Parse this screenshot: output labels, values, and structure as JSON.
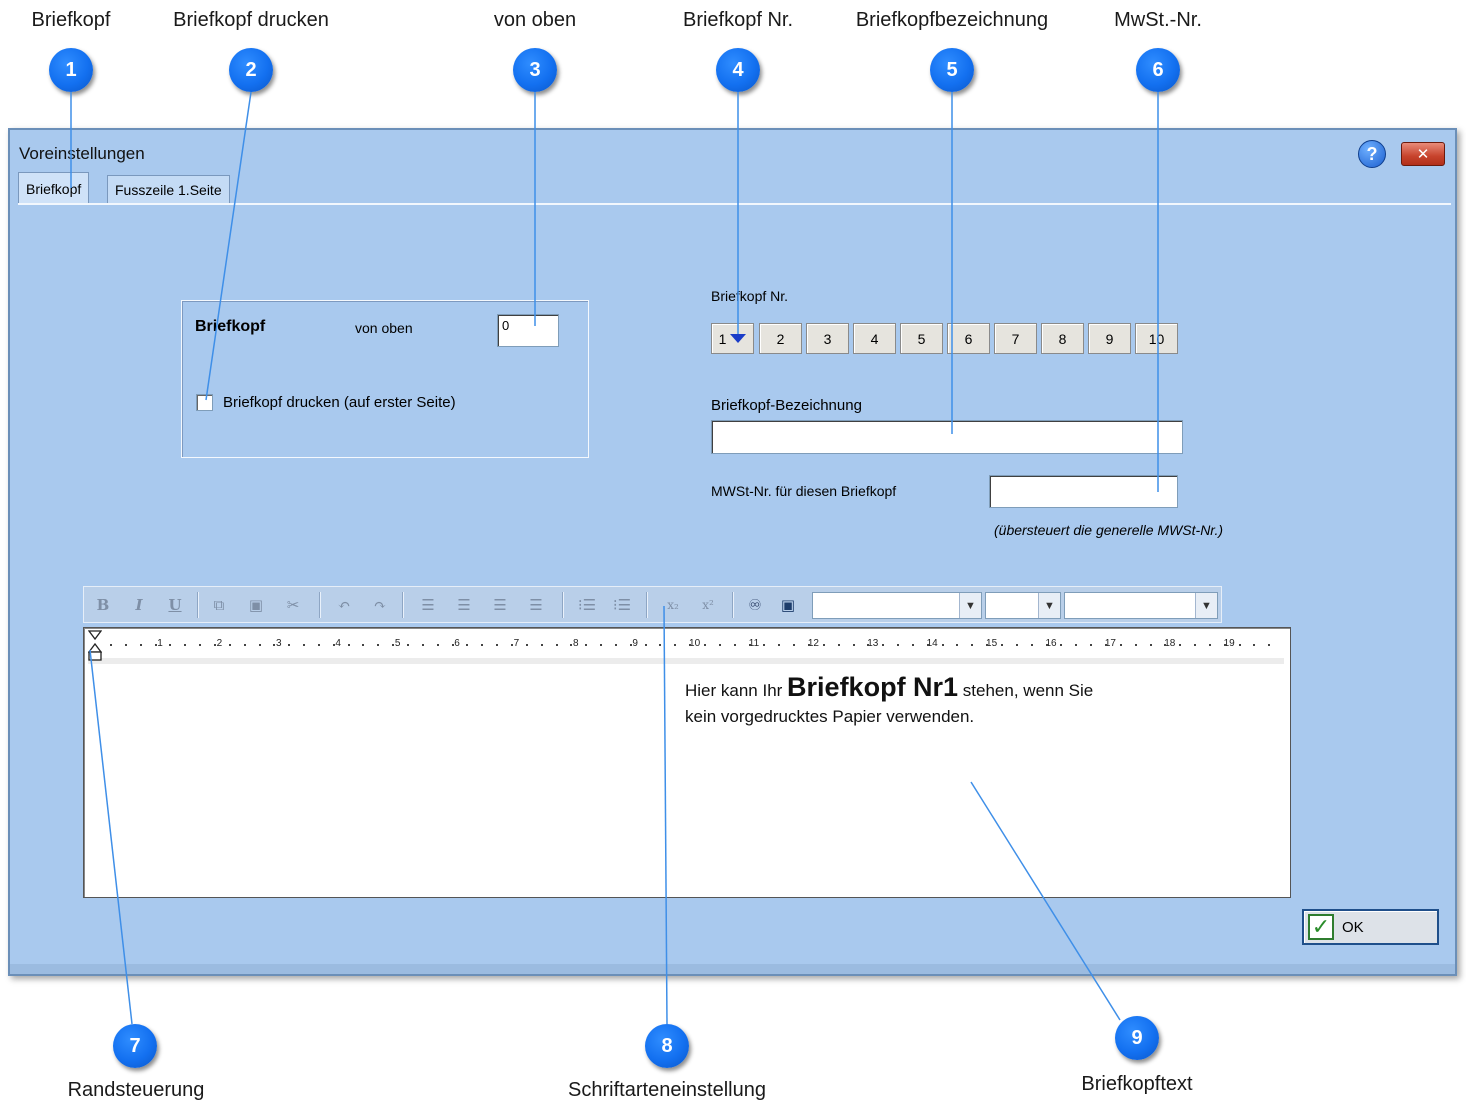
{
  "callouts": [
    {
      "n": "1",
      "label": "Briefkopf"
    },
    {
      "n": "2",
      "label": "Briefkopf drucken"
    },
    {
      "n": "3",
      "label": "von oben"
    },
    {
      "n": "4",
      "label": "Briefkopf Nr."
    },
    {
      "n": "5",
      "label": "Briefkopfbezeichnung"
    },
    {
      "n": "6",
      "label": "MwSt.-Nr."
    },
    {
      "n": "7",
      "label": "Randsteuerung"
    },
    {
      "n": "8",
      "label": "Schriftarteneinstellung"
    },
    {
      "n": "9",
      "label": "Briefkopftext"
    }
  ],
  "dialog": {
    "title": "Voreinstellungen",
    "help_symbol": "?",
    "close_symbol": "✕",
    "tabs": [
      "Briefkopf",
      "Fusszeile 1.Seite"
    ]
  },
  "briefkopf_group": {
    "heading": "Briefkopf",
    "von_oben_label": "von oben",
    "von_oben_value": "0",
    "print_checkbox_label": "Briefkopf drucken (auf erster Seite)",
    "print_checked": false
  },
  "briefkopf_nr": {
    "label": "Briefkopf Nr.",
    "buttons": [
      "1",
      "2",
      "3",
      "4",
      "5",
      "6",
      "7",
      "8",
      "9",
      "10"
    ],
    "selected": "1"
  },
  "bezeichnung": {
    "label": "Briefkopf-Bezeichnung",
    "value": ""
  },
  "mwst": {
    "label": "MWSt-Nr. für diesen Briefkopf",
    "value": "",
    "note": "(übersteuert die generelle MWSt-Nr.)"
  },
  "toolbar": {
    "icons": [
      "bold-icon",
      "italic-icon",
      "underline-icon",
      "copy-icon",
      "paste-icon",
      "cut-icon",
      "undo-icon",
      "redo-icon",
      "align-left-icon",
      "align-center-icon",
      "align-right-icon",
      "justify-icon",
      "bullet-list-icon",
      "numbered-list-icon",
      "subscript-icon",
      "superscript-icon",
      "find-icon",
      "insert-field-icon"
    ],
    "bold": "B",
    "italic": "I",
    "underline": "U",
    "font_name": "",
    "font_size": "",
    "font_color": ""
  },
  "ruler": {
    "numbers": [
      "1",
      "2",
      "3",
      "4",
      "5",
      "6",
      "7",
      "8",
      "9",
      "10",
      "11",
      "12",
      "13",
      "14",
      "15",
      "16",
      "17",
      "18",
      "19"
    ]
  },
  "editor": {
    "line1_pre": "Hier kann Ihr ",
    "line1_big": "Briefkopf Nr1",
    "line1_post": " stehen, wenn Sie",
    "line2": "kein vorgedrucktes Papier verwenden."
  },
  "ok_button": {
    "check": "✓",
    "label": "OK"
  },
  "colors": {
    "callout": "#1370f0",
    "dialog_bg": "#a9c9ee",
    "leader": "#3f8fe8"
  }
}
